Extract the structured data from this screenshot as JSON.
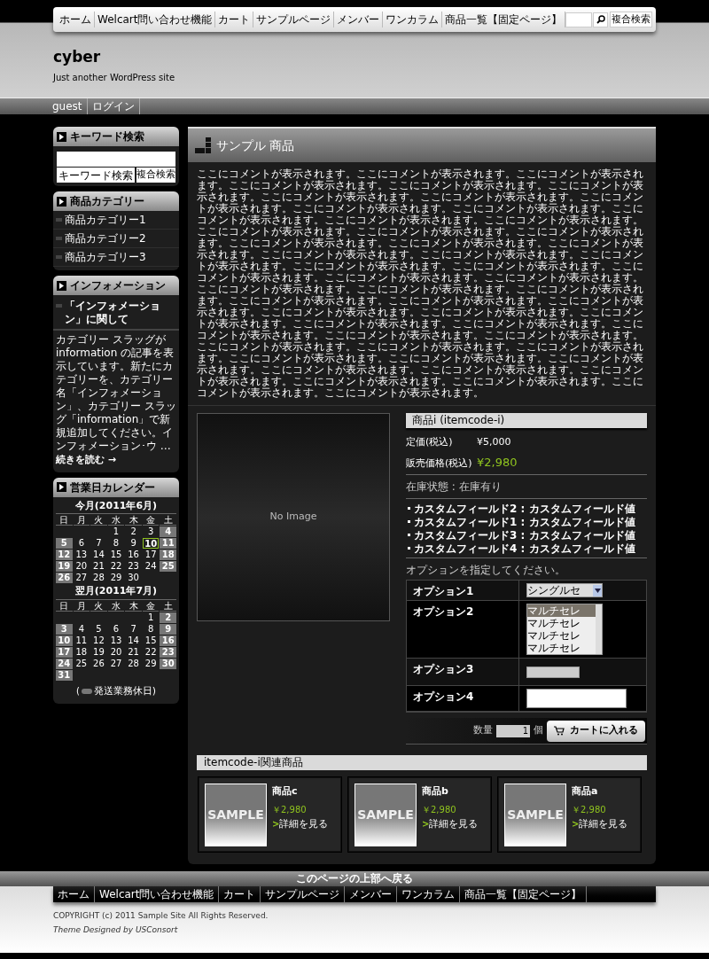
{
  "nav": {
    "items": [
      "ホーム",
      "Welcart問い合わせ機能",
      "カート",
      "サンプルページ",
      "メンバー",
      "ワンカラム",
      "商品一覧【固定ページ】"
    ],
    "search_button": "複合検索"
  },
  "site": {
    "title": "cyber",
    "tagline": "Just another WordPress site"
  },
  "user_bar": {
    "items": [
      "guest",
      "ログイン"
    ]
  },
  "sidebar": {
    "keyword_search": {
      "title": "キーワード検索",
      "buttons": [
        "キーワード検索",
        "複合検索"
      ]
    },
    "categories": {
      "title": "商品カテゴリー",
      "items": [
        "商品カテゴリー1",
        "商品カテゴリー2",
        "商品カテゴリー3"
      ]
    },
    "information": {
      "title": "インフォメーション",
      "post_title": "「インフォメーション」に関して",
      "excerpt": "カテゴリー スラッグが information の記事を表示しています。新たにカテゴリーを、カテゴリー名「インフォメーション」、カテゴリー スラッグ「information」で新規追加してください。インフォメーション･ウ …",
      "more": "続きを読む →"
    },
    "calendar": {
      "title": "営業日カレンダー",
      "legend_prefix": "(",
      "legend": "発送業務休日)",
      "months": [
        {
          "caption": "今月(2011年6月)",
          "weekdays": [
            "日",
            "月",
            "火",
            "水",
            "木",
            "金",
            "土"
          ],
          "weeks": [
            [
              {
                "day": "1",
                "holiday": false,
                "today": false
              },
              {
                "day": "2",
                "holiday": false,
                "today": false
              },
              {
                "day": "3",
                "holiday": false,
                "today": false
              },
              {
                "day": "4",
                "holiday": true,
                "today": false
              }
            ],
            [
              {
                "day": "5",
                "holiday": true,
                "today": false
              },
              {
                "day": "6",
                "holiday": false,
                "today": false
              },
              {
                "day": "7",
                "holiday": false,
                "today": false
              },
              {
                "day": "8",
                "holiday": false,
                "today": false
              },
              {
                "day": "9",
                "holiday": false,
                "today": false
              },
              {
                "day": "10",
                "holiday": false,
                "today": true
              },
              {
                "day": "11",
                "holiday": true,
                "today": false
              }
            ],
            [
              {
                "day": "12",
                "holiday": true,
                "today": false
              },
              {
                "day": "13",
                "holiday": false,
                "today": false
              },
              {
                "day": "14",
                "holiday": false,
                "today": false
              },
              {
                "day": "15",
                "holiday": false,
                "today": false
              },
              {
                "day": "16",
                "holiday": false,
                "today": false
              },
              {
                "day": "17",
                "holiday": false,
                "today": false
              },
              {
                "day": "18",
                "holiday": true,
                "today": false
              }
            ],
            [
              {
                "day": "19",
                "holiday": true,
                "today": false
              },
              {
                "day": "20",
                "holiday": false,
                "today": false
              },
              {
                "day": "21",
                "holiday": false,
                "today": false
              },
              {
                "day": "22",
                "holiday": false,
                "today": false
              },
              {
                "day": "23",
                "holiday": false,
                "today": false
              },
              {
                "day": "24",
                "holiday": false,
                "today": false
              },
              {
                "day": "25",
                "holiday": true,
                "today": false
              }
            ],
            [
              {
                "day": "26",
                "holiday": true,
                "today": false
              },
              {
                "day": "27",
                "holiday": false,
                "today": false
              },
              {
                "day": "28",
                "holiday": false,
                "today": false
              },
              {
                "day": "29",
                "holiday": false,
                "today": false
              },
              {
                "day": "30",
                "holiday": false,
                "today": false
              }
            ]
          ]
        },
        {
          "caption": "翌月(2011年7月)",
          "weekdays": [
            "日",
            "月",
            "火",
            "水",
            "木",
            "金",
            "土"
          ],
          "weeks": [
            [
              {
                "day": "1",
                "holiday": false,
                "today": false
              },
              {
                "day": "2",
                "holiday": true,
                "today": false
              }
            ],
            [
              {
                "day": "3",
                "holiday": true,
                "today": false
              },
              {
                "day": "4",
                "holiday": false,
                "today": false
              },
              {
                "day": "5",
                "holiday": false,
                "today": false
              },
              {
                "day": "6",
                "holiday": false,
                "today": false
              },
              {
                "day": "7",
                "holiday": false,
                "today": false
              },
              {
                "day": "8",
                "holiday": false,
                "today": false
              },
              {
                "day": "9",
                "holiday": true,
                "today": false
              }
            ],
            [
              {
                "day": "10",
                "holiday": true,
                "today": false
              },
              {
                "day": "11",
                "holiday": false,
                "today": false
              },
              {
                "day": "12",
                "holiday": false,
                "today": false
              },
              {
                "day": "13",
                "holiday": false,
                "today": false
              },
              {
                "day": "14",
                "holiday": false,
                "today": false
              },
              {
                "day": "15",
                "holiday": false,
                "today": false
              },
              {
                "day": "16",
                "holiday": true,
                "today": false
              }
            ],
            [
              {
                "day": "17",
                "holiday": true,
                "today": false
              },
              {
                "day": "18",
                "holiday": false,
                "today": false
              },
              {
                "day": "19",
                "holiday": false,
                "today": false
              },
              {
                "day": "20",
                "holiday": false,
                "today": false
              },
              {
                "day": "21",
                "holiday": false,
                "today": false
              },
              {
                "day": "22",
                "holiday": false,
                "today": false
              },
              {
                "day": "23",
                "holiday": true,
                "today": false
              }
            ],
            [
              {
                "day": "24",
                "holiday": true,
                "today": false
              },
              {
                "day": "25",
                "holiday": false,
                "today": false
              },
              {
                "day": "26",
                "holiday": false,
                "today": false
              },
              {
                "day": "27",
                "holiday": false,
                "today": false
              },
              {
                "day": "28",
                "holiday": false,
                "today": false
              },
              {
                "day": "29",
                "holiday": false,
                "today": false
              },
              {
                "day": "30",
                "holiday": true,
                "today": false
              }
            ],
            [
              {
                "day": "31",
                "holiday": true,
                "today": false
              }
            ]
          ]
        }
      ]
    }
  },
  "main": {
    "title": "サンプル 商品",
    "description": "ここにコメントが表示されます。ここにコメントが表示されます。ここにコメントが表示されます。ここにコメントが表示されます。ここにコメントが表示されます。ここにコメントが表示されます。ここにコメントが表示されます。ここにコメントが表示されます。ここにコメントが表示されます。ここにコメントが表示されます。ここにコメントが表示されます。ここにコメントが表示されます。ここにコメントが表示されます。ここにコメントが表示されます。ここにコメントが表示されます。ここにコメントが表示されます。ここにコメントが表示されます。ここにコメントが表示されます。ここにコメントが表示されます。ここにコメントが表示されます。ここにコメントが表示されます。ここにコメントが表示されます。ここにコメントが表示されます。ここにコメントが表示されます。ここにコメントが表示されます。ここにコメントが表示されます。ここにコメントが表示されます。ここにコメントが表示されます。ここにコメントが表示されます。ここにコメントが表示されます。ここにコメントが表示されます。ここにコメントが表示されます。ここにコメントが表示されます。ここにコメントが表示されます。ここにコメントが表示されます。ここにコメントが表示されます。ここにコメントが表示されます。ここにコメントが表示されます。ここにコメントが表示されます。ここにコメントが表示されます。ここにコメントが表示されます。ここにコメントが表示されます。ここにコメントが表示されます。ここにコメントが表示されます。ここにコメントが表示されます。ここにコメントが表示されます。ここにコメントが表示されます。ここにコメントが表示されます。ここにコメントが表示されます。ここにコメントが表示されます。ここにコメントが表示されます。ここにコメントが表示されます。ここにコメントが表示されます。ここにコメントが表示されます。ここにコメントが表示されます。",
    "product": {
      "name": "商品i (itemcode-i)",
      "image_text": "No Image",
      "list_price_label": "定価",
      "list_tax_note": "(税込)",
      "list_price": "¥5,000",
      "sale_price_label": "販売価格",
      "sale_tax_note": "(税込)",
      "sale_price": "¥2,980",
      "stock": "在庫状態 : 在庫有り",
      "custom_fields": [
        "カスタムフィールド2 : カスタムフィールド値",
        "カスタムフィールド1 : カスタムフィールド値",
        "カスタムフィールド3 : カスタムフィールド値",
        "カスタムフィールド4 : カスタムフィールド値"
      ],
      "options_prompt": "オプションを指定してください。",
      "options": [
        {
          "kind": "select",
          "label": "オプション1",
          "value": "シングルセ"
        },
        {
          "kind": "multiselect",
          "label": "オプション2",
          "choices": [
            {
              "text": "マルチセレ",
              "selected": true
            },
            {
              "text": "マルチセレ",
              "selected": false
            },
            {
              "text": "マルチセレ",
              "selected": false
            },
            {
              "text": "マルチセレ",
              "selected": false
            }
          ]
        },
        {
          "kind": "text",
          "label": "オプション3"
        },
        {
          "kind": "textarea",
          "label": "オプション4"
        }
      ],
      "quantity_label": "数量",
      "quantity": "1",
      "unit": "個",
      "cart_button": "カートに入れる"
    },
    "related": {
      "title": "itemcode-i関連商品",
      "items": [
        {
          "name": "商品c",
          "price": "￥2,980",
          "marker": ">",
          "link": "詳細を見る",
          "image_text": "SAMPLE"
        },
        {
          "name": "商品b",
          "price": "￥2,980",
          "marker": ">",
          "link": "詳細を見る",
          "image_text": "SAMPLE"
        },
        {
          "name": "商品a",
          "price": "￥2,980",
          "marker": ">",
          "link": "詳細を見る",
          "image_text": "SAMPLE"
        }
      ]
    }
  },
  "footer": {
    "back_to_top": "このページの上部へ戻る",
    "nav": [
      "ホーム",
      "Welcart問い合わせ機能",
      "カート",
      "サンプルページ",
      "メンバー",
      "ワンカラム",
      "商品一覧【固定ページ】"
    ],
    "copyright": "COPYRIGHT (c) 2011 Sample Site All Rights Reserved.",
    "credit": "Theme Designed by USConsort"
  }
}
